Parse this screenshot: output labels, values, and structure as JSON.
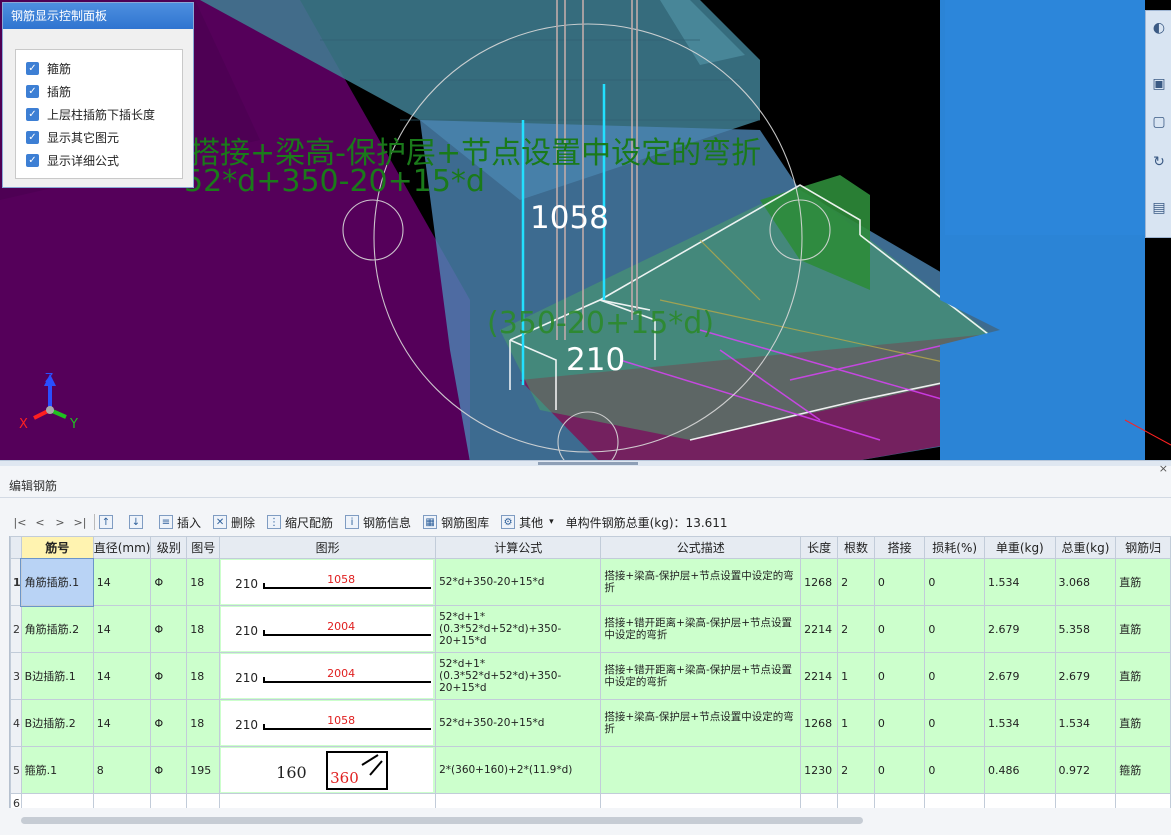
{
  "control_panel": {
    "title": "钢筋显示控制面板",
    "options": [
      {
        "label": "箍筋",
        "checked": true
      },
      {
        "label": "插筋",
        "checked": true
      },
      {
        "label": "上层柱插筋下插长度",
        "checked": true
      },
      {
        "label": "显示其它图元",
        "checked": true
      },
      {
        "label": "显示详细公式",
        "checked": true
      }
    ]
  },
  "viewport": {
    "overlay_description": "搭接+梁高-保护层+节点设置中设定的弯折",
    "overlay_formula": "52*d+350-20+15*d",
    "overlay_subformula": "(350-20+15*d)",
    "dim_vertical": "1058",
    "dim_horizontal": "210",
    "axis": {
      "x": "X",
      "y": "Y",
      "z": "Z"
    }
  },
  "editor": {
    "title": "编辑钢筋",
    "close": "×",
    "toolbar": {
      "nav_first": "|<",
      "nav_prev": "<",
      "nav_next": ">",
      "nav_last": ">|",
      "insert": "插入",
      "delete": "删除",
      "scale": "缩尺配筋",
      "info": "钢筋信息",
      "library": "钢筋图库",
      "other": "其他",
      "total_weight": "单构件钢筋总重(kg)：13.611"
    },
    "columns": [
      "筋号",
      "直径(mm)",
      "级别",
      "图号",
      "图形",
      "计算公式",
      "公式描述",
      "长度",
      "根数",
      "搭接",
      "损耗(%)",
      "单重(kg)",
      "总重(kg)",
      "钢筋归"
    ],
    "rows": [
      {
        "num": "1",
        "name": "角筋插筋.1",
        "diameter": "14",
        "grade": "Φ",
        "fig": "18",
        "shape_left": "210",
        "shape_value": "1058",
        "formula": "52*d+350-20+15*d",
        "desc": "搭接+梁高-保护层+节点设置中设定的弯折",
        "length": "1268",
        "count": "2",
        "lap": "0",
        "loss": "0",
        "unit_weight": "1.534",
        "total_weight": "3.068",
        "category": "直筋"
      },
      {
        "num": "2",
        "name": "角筋插筋.2",
        "diameter": "14",
        "grade": "Φ",
        "fig": "18",
        "shape_left": "210",
        "shape_value": "2004",
        "formula": "52*d+1*(0.3*52*d+52*d)+350-20+15*d",
        "desc": "搭接+错开距离+梁高-保护层+节点设置中设定的弯折",
        "length": "2214",
        "count": "2",
        "lap": "0",
        "loss": "0",
        "unit_weight": "2.679",
        "total_weight": "5.358",
        "category": "直筋"
      },
      {
        "num": "3",
        "name": "B边插筋.1",
        "diameter": "14",
        "grade": "Φ",
        "fig": "18",
        "shape_left": "210",
        "shape_value": "2004",
        "formula": "52*d+1*(0.3*52*d+52*d)+350-20+15*d",
        "desc": "搭接+错开距离+梁高-保护层+节点设置中设定的弯折",
        "length": "2214",
        "count": "1",
        "lap": "0",
        "loss": "0",
        "unit_weight": "2.679",
        "total_weight": "2.679",
        "category": "直筋"
      },
      {
        "num": "4",
        "name": "B边插筋.2",
        "diameter": "14",
        "grade": "Φ",
        "fig": "18",
        "shape_left": "210",
        "shape_value": "1058",
        "formula": "52*d+350-20+15*d",
        "desc": "搭接+梁高-保护层+节点设置中设定的弯折",
        "length": "1268",
        "count": "1",
        "lap": "0",
        "loss": "0",
        "unit_weight": "1.534",
        "total_weight": "1.534",
        "category": "直筋"
      },
      {
        "num": "5",
        "name": "箍筋.1",
        "diameter": "8",
        "grade": "Φ",
        "fig": "195",
        "shape_left": "160",
        "shape_value": "360",
        "formula": "2*(360+160)+2*(11.9*d)",
        "desc": "",
        "length": "1230",
        "count": "2",
        "lap": "0",
        "loss": "0",
        "unit_weight": "0.486",
        "total_weight": "0.972",
        "category": "箍筋"
      }
    ],
    "empty_row_num": "6"
  },
  "colors": {
    "row_bg": "#ccffcc",
    "selected_cell": "#b9d3f5",
    "shape_value": "#e02020",
    "overlay_text": "#1a7a1a",
    "panel_title": "#2f74d0"
  }
}
